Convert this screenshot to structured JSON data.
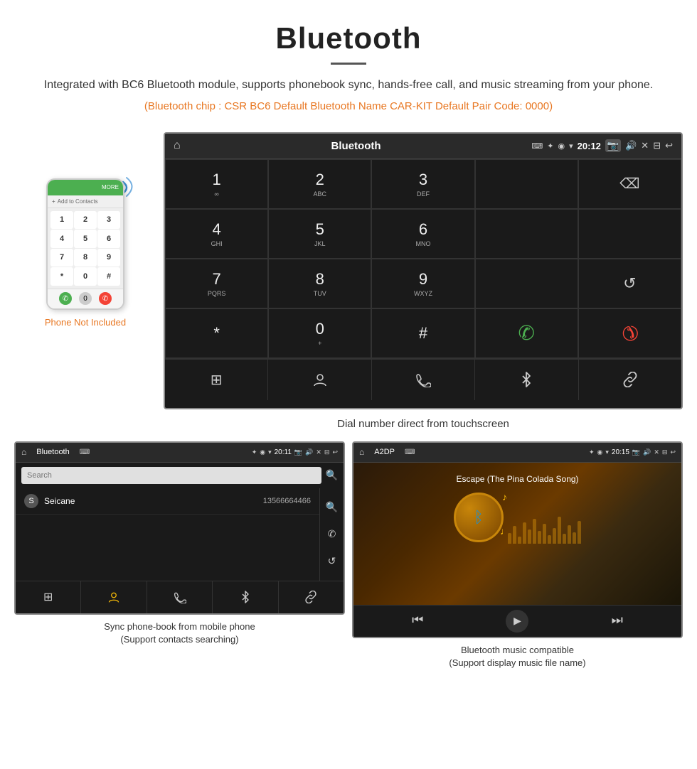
{
  "header": {
    "title": "Bluetooth",
    "description": "Integrated with BC6 Bluetooth module, supports phonebook sync, hands-free call, and music streaming from your phone.",
    "specs": "(Bluetooth chip : CSR BC6    Default Bluetooth Name CAR-KIT    Default Pair Code: 0000)"
  },
  "phone_sidebar": {
    "not_included": "Phone Not Included"
  },
  "car_screen": {
    "status_bar": {
      "title": "Bluetooth",
      "time": "20:12",
      "usb_icon": "⌨",
      "bt_icon": "✦",
      "location_icon": "▾",
      "wifi_icon": "▾",
      "home_icon": "⌂"
    },
    "dialpad": {
      "keys": [
        {
          "digit": "1",
          "sub": "∞"
        },
        {
          "digit": "2",
          "sub": "ABC"
        },
        {
          "digit": "3",
          "sub": "DEF"
        },
        {
          "digit": "",
          "sub": ""
        },
        {
          "digit": "⌫",
          "sub": ""
        },
        {
          "digit": "4",
          "sub": "GHI"
        },
        {
          "digit": "5",
          "sub": "JKL"
        },
        {
          "digit": "6",
          "sub": "MNO"
        },
        {
          "digit": "",
          "sub": ""
        },
        {
          "digit": "",
          "sub": ""
        },
        {
          "digit": "7",
          "sub": "PQRS"
        },
        {
          "digit": "8",
          "sub": "TUV"
        },
        {
          "digit": "9",
          "sub": "WXYZ"
        },
        {
          "digit": "",
          "sub": ""
        },
        {
          "digit": "↺",
          "sub": ""
        },
        {
          "digit": "*",
          "sub": ""
        },
        {
          "digit": "0",
          "sub": "+"
        },
        {
          "digit": "#",
          "sub": ""
        },
        {
          "digit": "✆",
          "sub": ""
        },
        {
          "digit": "✆",
          "sub": "end"
        }
      ]
    },
    "bottom_nav": {
      "items": [
        "⊞",
        "👤",
        "✆",
        "✦",
        "🔗"
      ]
    }
  },
  "caption": "Dial number direct from touchscreen",
  "phonebook_screen": {
    "status": {
      "title": "Bluetooth",
      "usb": "⌨",
      "time": "20:11",
      "home": "⌂"
    },
    "search_placeholder": "Search",
    "contact": {
      "letter": "S",
      "name": "Seicane",
      "number": "13566664466"
    },
    "bottom_caption": "Sync phone-book from mobile phone\n(Support contacts searching)"
  },
  "music_screen": {
    "status": {
      "title": "A2DP",
      "usb": "⌨",
      "time": "20:15",
      "home": "⌂"
    },
    "song_title": "Escape (The Pina Colada Song)",
    "controls": [
      "⏮",
      "⏭▐",
      "⏭"
    ],
    "bottom_caption": "Bluetooth music compatible\n(Support display music file name)"
  },
  "colors": {
    "orange": "#e87722",
    "green": "#4CAF50",
    "red": "#f44336",
    "dark_bg": "#1a1a1a",
    "status_bg": "#2a2a2a"
  }
}
